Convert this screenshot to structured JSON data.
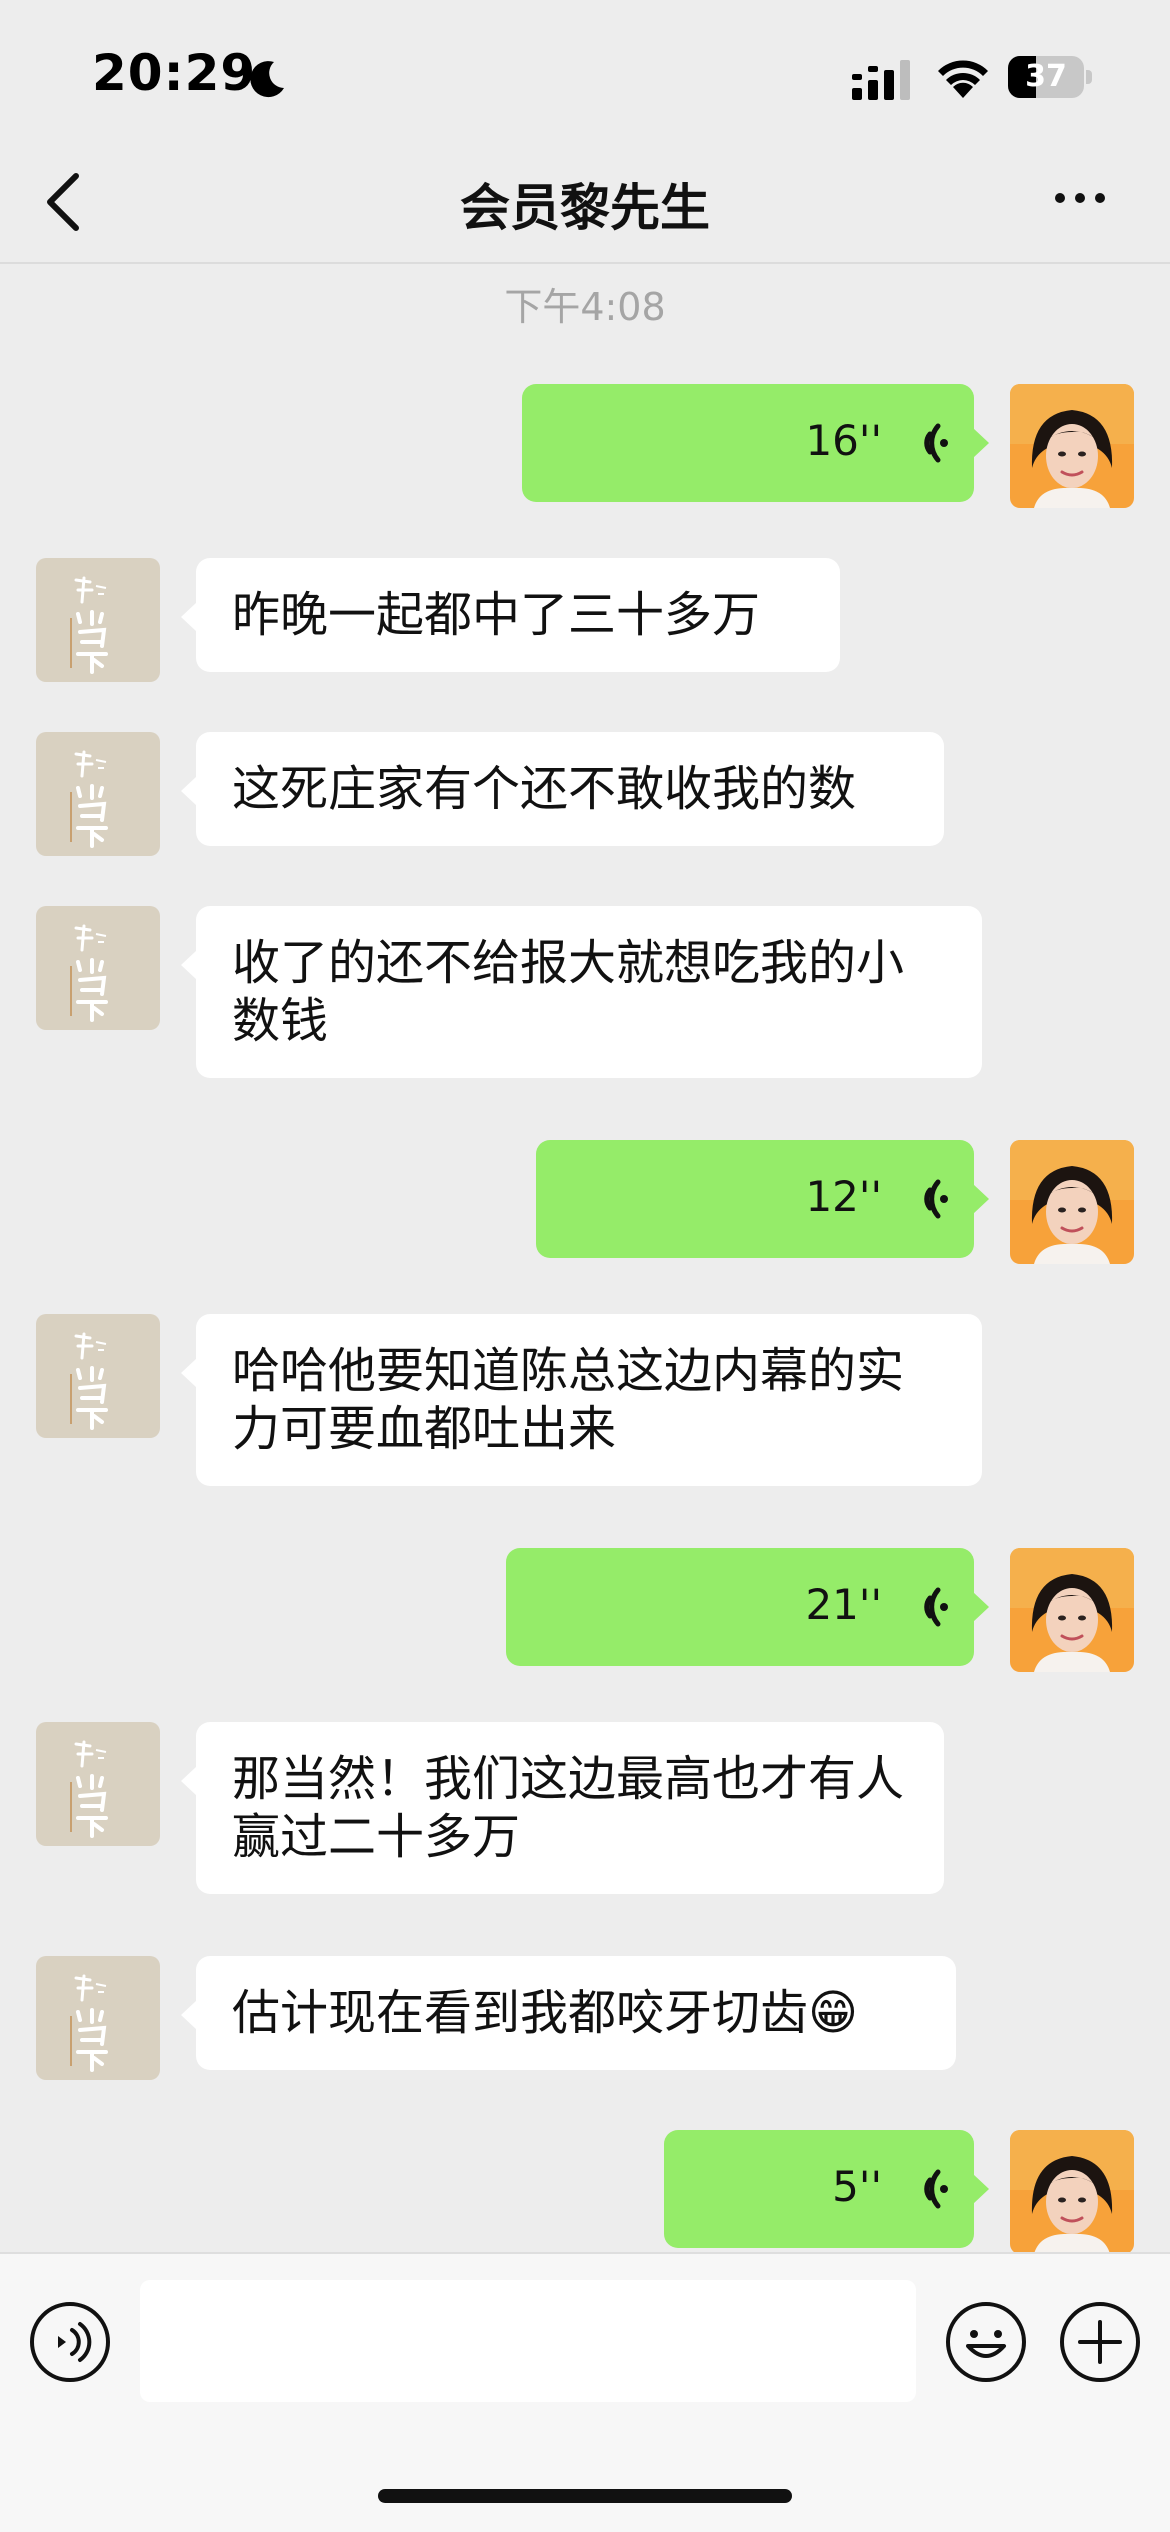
{
  "status_bar": {
    "time": "20:29",
    "battery": "37",
    "battery_level": 0.37
  },
  "nav": {
    "title": "会员黎先生"
  },
  "chat": {
    "timestamp": "下午4:08",
    "messages": [
      {
        "side": "out",
        "type": "voice",
        "duration": "16''"
      },
      {
        "side": "in",
        "type": "text",
        "text": "昨晚一起都中了三十多万"
      },
      {
        "side": "in",
        "type": "text",
        "text": "这死庄家有个还不敢收我的数"
      },
      {
        "side": "in",
        "type": "text",
        "text": "收了的还不给报大就想吃我的小数钱"
      },
      {
        "side": "out",
        "type": "voice",
        "duration": "12''"
      },
      {
        "side": "in",
        "type": "text",
        "text": "哈哈他要知道陈总这边内幕的实力可要血都吐出来"
      },
      {
        "side": "out",
        "type": "voice",
        "duration": "21''"
      },
      {
        "side": "in",
        "type": "text",
        "text": "那当然！我们这边最高也才有人赢过二十多万"
      },
      {
        "side": "in",
        "type": "text",
        "text": "估计现在看到我都咬牙切齿😁"
      },
      {
        "side": "out",
        "type": "voice",
        "duration": "5''"
      }
    ]
  },
  "colors": {
    "bubble_out": "#95ec69",
    "bubble_in": "#ffffff",
    "background": "#ededed"
  },
  "icons": [
    "moon-icon",
    "signal-icon",
    "wifi-icon",
    "battery-icon",
    "back-icon",
    "more-icon",
    "voice-wave-icon",
    "voice-input-icon",
    "emoji-icon",
    "plus-icon"
  ]
}
